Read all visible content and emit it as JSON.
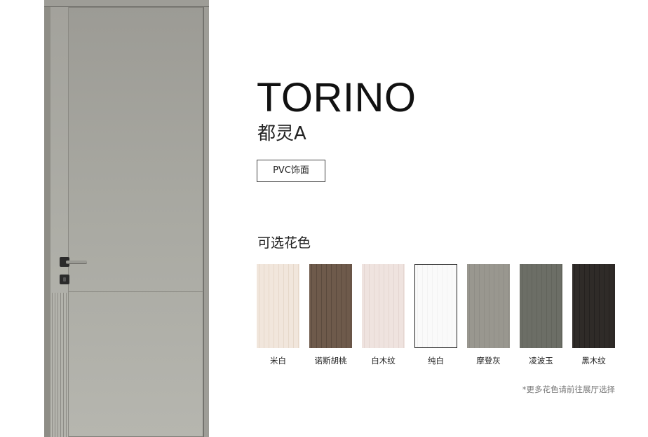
{
  "product": {
    "title": "TORINO",
    "subtitle": "都灵A",
    "finish_tag": "PVC饰面"
  },
  "colors": {
    "label": "可选花色",
    "options": [
      {
        "name": "米白",
        "color": "#f1e6dc",
        "accent": "#e6d8ca"
      },
      {
        "name": "诺斯胡桃",
        "color": "#6e5a4b",
        "accent": "#5b4a3d"
      },
      {
        "name": "白木纹",
        "color": "#efe3df",
        "accent": "#e4d6d1"
      },
      {
        "name": "纯白",
        "color": "#fafafa",
        "accent": "#f2f2f2"
      },
      {
        "name": "摩登灰",
        "color": "#99978f",
        "accent": "#8f8d86"
      },
      {
        "name": "凌波玉",
        "color": "#6c6e66",
        "accent": "#62645c"
      },
      {
        "name": "黑木纹",
        "color": "#2f2b28",
        "accent": "#24211f"
      }
    ],
    "note": "*更多花色请前往展厅选择"
  }
}
